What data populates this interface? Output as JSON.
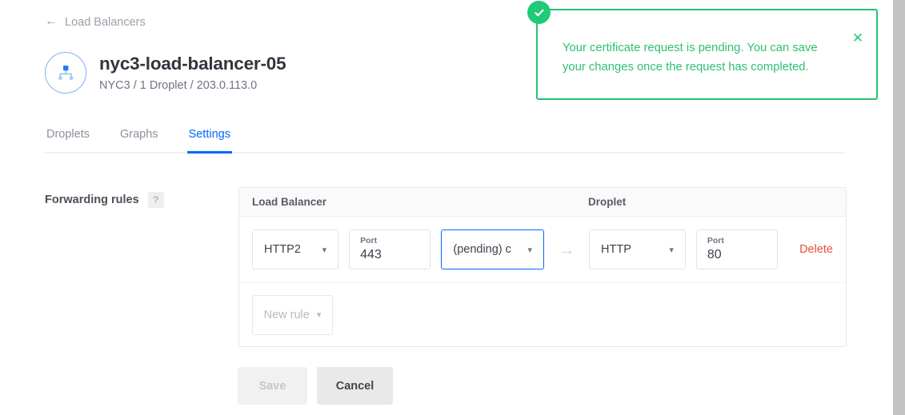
{
  "breadcrumb": {
    "back_icon": "arrow-left-icon",
    "label": "Load Balancers"
  },
  "header": {
    "icon": "load-balancer-icon",
    "title": "nyc3-load-balancer-05",
    "subtitle": "NYC3 / 1 Droplet / 203.0.113.0"
  },
  "tabs": [
    {
      "label": "Droplets",
      "active": false
    },
    {
      "label": "Graphs",
      "active": false
    },
    {
      "label": "Settings",
      "active": true
    }
  ],
  "settings": {
    "section_label": "Forwarding rules",
    "help_glyph": "?",
    "table": {
      "headers": {
        "load_balancer": "Load Balancer",
        "droplet": "Droplet"
      },
      "rows": [
        {
          "lb_protocol": "HTTP2",
          "lb_port_label": "Port",
          "lb_port_value": "443",
          "certificate": "(pending) c",
          "flow_icon": "arrow-right-icon",
          "droplet_protocol": "HTTP",
          "droplet_port_label": "Port",
          "droplet_port_value": "80",
          "delete_label": "Delete"
        }
      ],
      "new_rule_label": "New rule"
    },
    "buttons": {
      "save": "Save",
      "cancel": "Cancel"
    }
  },
  "notice": {
    "status_icon": "success-check-icon",
    "close_icon": "close-icon",
    "message": "Your certificate request is pending. You can save your changes once the request has completed."
  },
  "colors": {
    "accent_blue": "#0069ff",
    "success_green": "#22c278",
    "danger_red": "#e8503a",
    "text_primary": "#31353d",
    "text_muted": "#8b919b",
    "border": "#e5e8eb"
  }
}
